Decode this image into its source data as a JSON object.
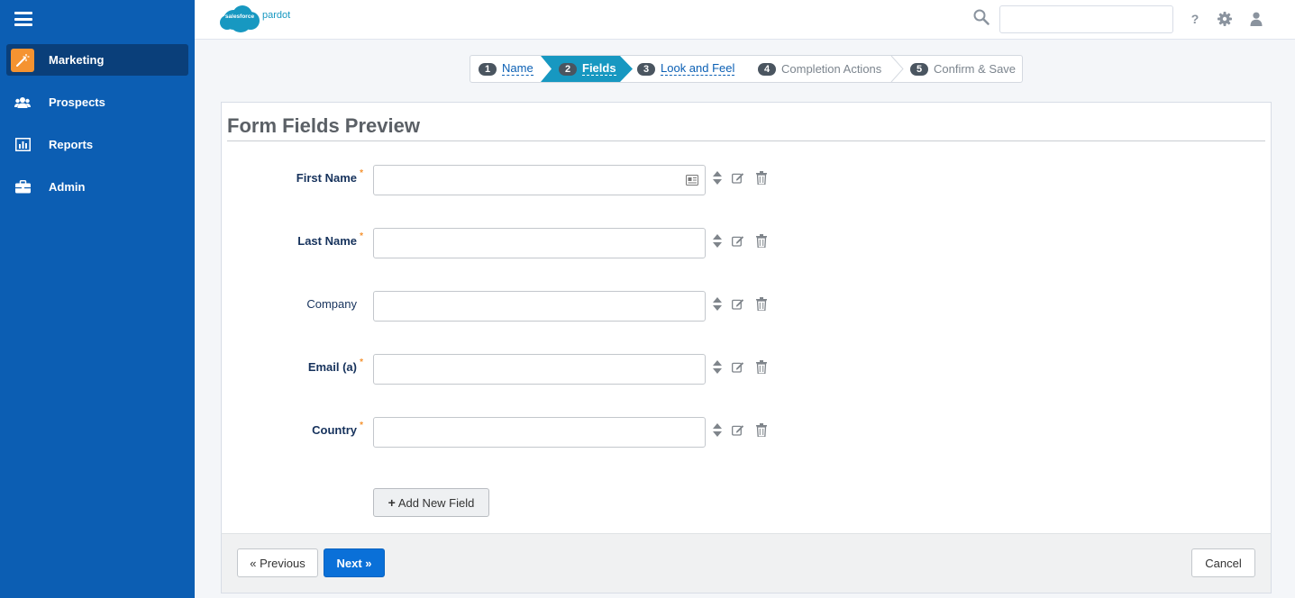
{
  "app": {
    "logo_badge": "salesforce",
    "logo_text": "pardot"
  },
  "sidebar": {
    "items": [
      {
        "label": "Marketing",
        "icon": "marketing-wand-icon",
        "active": true
      },
      {
        "label": "Prospects",
        "icon": "users-icon",
        "active": false
      },
      {
        "label": "Reports",
        "icon": "bar-chart-icon",
        "active": false
      },
      {
        "label": "Admin",
        "icon": "briefcase-icon",
        "active": false
      }
    ]
  },
  "topbar": {
    "search_value": "",
    "help_glyph": "?"
  },
  "wizard": {
    "steps": [
      {
        "num": "1",
        "label": "Name",
        "state": "link"
      },
      {
        "num": "2",
        "label": "Fields",
        "state": "active"
      },
      {
        "num": "3",
        "label": "Look and Feel",
        "state": "link"
      },
      {
        "num": "4",
        "label": "Completion Actions",
        "state": "muted"
      },
      {
        "num": "5",
        "label": "Confirm & Save",
        "state": "muted"
      }
    ]
  },
  "panel": {
    "title": "Form Fields Preview",
    "fields": [
      {
        "label": "First Name",
        "required": true,
        "value": ""
      },
      {
        "label": "Last Name",
        "required": true,
        "value": ""
      },
      {
        "label": "Company",
        "required": false,
        "value": ""
      },
      {
        "label": "Email (a)",
        "required": true,
        "value": ""
      },
      {
        "label": "Country",
        "required": true,
        "value": ""
      }
    ],
    "required_marker": "*",
    "add_field_plus": "+",
    "add_field_label": "Add New Field"
  },
  "footer": {
    "previous_label": "« Previous",
    "next_label": "Next »",
    "cancel_label": "Cancel"
  },
  "colors": {
    "sidebar_bg": "#0c5eb3",
    "sidebar_active": "#0a3f7a",
    "accent_orange": "#f59331",
    "wizard_active": "#1798c1",
    "primary_button": "#0a70d8"
  }
}
